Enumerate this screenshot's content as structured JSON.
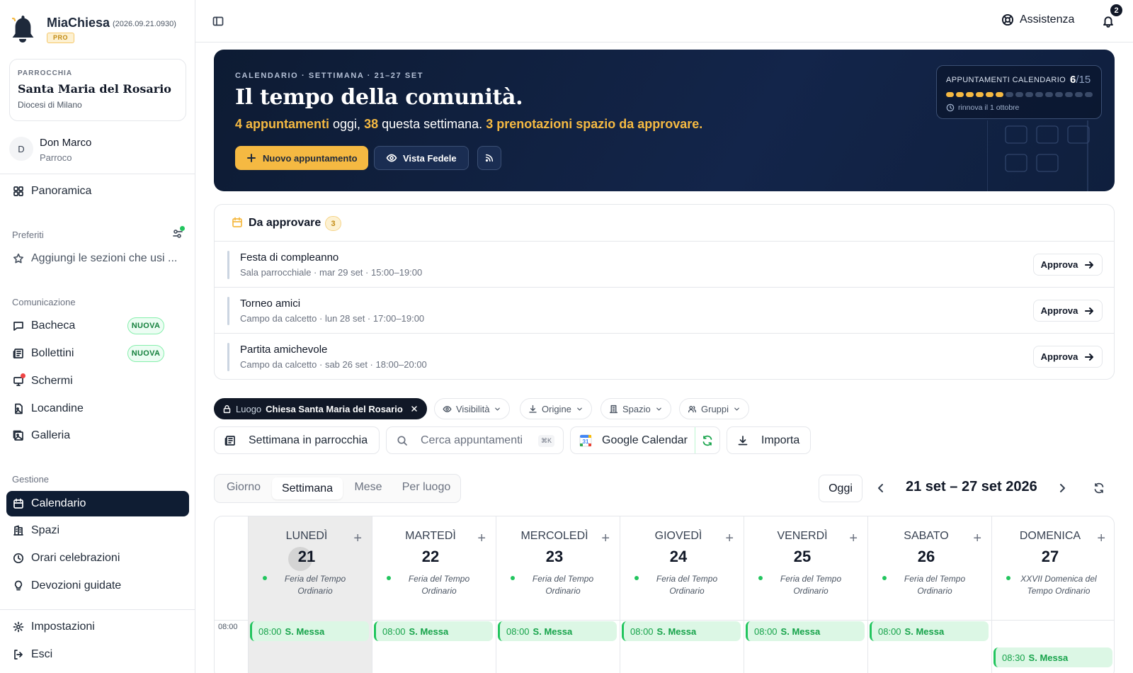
{
  "app": {
    "name": "MiaChiesa",
    "version": "(2026.09.21.0930)",
    "badge": "PRO"
  },
  "parish": {
    "label": "PARROCCHIA",
    "name": "Santa Maria del Rosario",
    "diocese": "Diocesi di Milano"
  },
  "user": {
    "initial": "D",
    "name": "Don Marco",
    "role": "Parroco"
  },
  "sidebar": {
    "overview": "Panoramica",
    "favorites_label": "Preferiti",
    "favorites_hint": "Aggiungi le sezioni che usi ...",
    "comm_label": "Comunicazione",
    "comm_items": [
      {
        "label": "Bacheca",
        "badge": "NUOVA"
      },
      {
        "label": "Bollettini",
        "badge": "NUOVA"
      },
      {
        "label": "Schermi"
      },
      {
        "label": "Locandine"
      },
      {
        "label": "Galleria"
      }
    ],
    "mgmt_label": "Gestione",
    "mgmt_items": [
      {
        "label": "Calendario",
        "active": true
      },
      {
        "label": "Spazi"
      },
      {
        "label": "Orari celebrazioni"
      },
      {
        "label": "Devozioni guidate"
      }
    ],
    "settings": "Impostazioni",
    "logout": "Esci"
  },
  "topbar": {
    "help": "Assistenza",
    "notifications_count": "2"
  },
  "hero": {
    "eyebrow": "CALENDARIO · SETTIMANA · 21–27 SET",
    "title": "Il tempo della comunità.",
    "summary": {
      "today_bold": "4 appuntamenti",
      "today_rest": " oggi, ",
      "week_bold": "38",
      "week_rest": " questa settimana. ",
      "pending_bold": "3 prenotazioni spazio da approvare."
    },
    "new_button": "Nuovo appuntamento",
    "faithful_button": "Vista Fedele",
    "quota": {
      "label": "APPUNTAMENTI CALENDARIO",
      "used": "6",
      "total": "/15",
      "renew": "rinnova il 1 ottobre",
      "used_count": 6,
      "total_count": 15
    },
    "accent_color": "#f5b942"
  },
  "approvals": {
    "title": "Da approvare",
    "count": "3",
    "button": "Approva",
    "items": [
      {
        "title": "Festa di compleanno",
        "detail": "Sala parrocchiale · mar 29 set · 15:00–19:00"
      },
      {
        "title": "Torneo amici",
        "detail": "Campo da calcetto · lun 28 set · 17:00–19:00"
      },
      {
        "title": "Partita amichevole",
        "detail": "Campo da calcetto · sab 26 set · 18:00–20:00"
      }
    ]
  },
  "filters": {
    "place_label": "Luogo",
    "place_value": "Chiesa Santa Maria del Rosario",
    "visibility": "Visibilità",
    "origin": "Origine",
    "space": "Spazio",
    "groups": "Gruppi"
  },
  "tools": {
    "week_in_parish": "Settimana in parrocchia",
    "search_placeholder": "Cerca appuntamenti",
    "search_shortcut": "⌘K",
    "google_calendar": "Google Calendar",
    "import": "Importa"
  },
  "views": {
    "tabs": [
      "Giorno",
      "Settimana",
      "Mese",
      "Per luogo"
    ],
    "active": "Settimana",
    "today": "Oggi",
    "range": "21 set – 27 set 2026"
  },
  "calendar": {
    "hour_label": "08:00",
    "days": [
      {
        "name": "LUNEDÌ",
        "num": "21",
        "feria": "Feria del Tempo Ordinario",
        "event_time": "08:00",
        "event_title": "S. Messa",
        "today": true
      },
      {
        "name": "MARTEDÌ",
        "num": "22",
        "feria": "Feria del Tempo Ordinario",
        "event_time": "08:00",
        "event_title": "S. Messa"
      },
      {
        "name": "MERCOLEDÌ",
        "num": "23",
        "feria": "Feria del Tempo Ordinario",
        "event_time": "08:00",
        "event_title": "S. Messa"
      },
      {
        "name": "GIOVEDÌ",
        "num": "24",
        "feria": "Feria del Tempo Ordinario",
        "event_time": "08:00",
        "event_title": "S. Messa"
      },
      {
        "name": "VENERDÌ",
        "num": "25",
        "feria": "Feria del Tempo Ordinario",
        "event_time": "08:00",
        "event_title": "S. Messa"
      },
      {
        "name": "SABATO",
        "num": "26",
        "feria": "Feria del Tempo Ordinario",
        "event_time": "08:00",
        "event_title": "S. Messa"
      },
      {
        "name": "DOMENICA",
        "num": "27",
        "feria": "XXVII Domenica del Tempo Ordinario",
        "event_time": "08:30",
        "event_title": "S. Messa"
      }
    ]
  }
}
